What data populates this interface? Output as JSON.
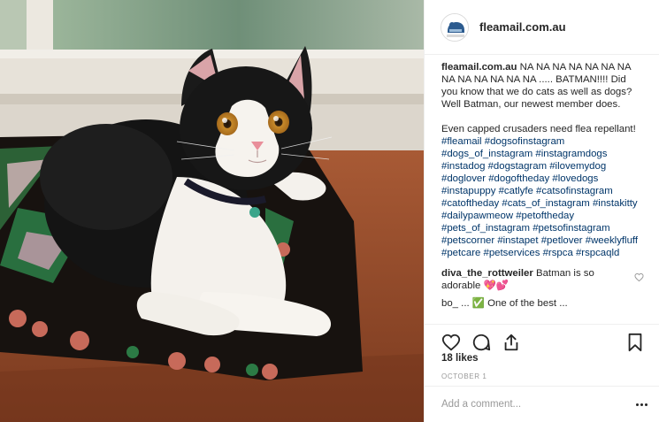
{
  "post": {
    "image_alt": "Black and white kitten lying on a crocheted blanket on a windowsill",
    "account": {
      "username": "fleamail.com.au",
      "avatar_label": "FLEAMAIL"
    },
    "caption": {
      "username": "fleamail.com.au",
      "line1": " NA NA NA NA NA NA NA NA NA NA NA NA NA ..... BATMAN!!!! Did you know that we do cats as well as dogs? Well Batman, our newest member does.",
      "line2": "Even capped crusaders need flea repellant!",
      "hashtags": "#fleamail #dogsofinstagram #dogs_of_instagram #instagramdogs #instadog #dogstagram #ilovemydog #doglover #dogoftheday #lovedogs #instapuppy #catlyfe #catsofinstagram #catoftheday #cats_of_instagram #instakitty #dailypawmeow #petoftheday #pets_of_instagram #petsofinstagram #petscorner #instapet #petlover #weeklyfluff #petcare #petservices #rspca #rspcaqld"
    },
    "comments": [
      {
        "username": "diva_the_rottweiler",
        "text": " Batman is so adorable 💖💕"
      },
      {
        "username": "bo_",
        "text": "",
        "partial": "bo_ ...  ✅ One of the best ..."
      }
    ],
    "likes": "18 likes",
    "date": "OCTOBER 1",
    "add_comment_placeholder": "Add a comment...",
    "icons": {
      "like": "heart-outline-icon",
      "comment": "speech-bubble-icon",
      "share": "share-upload-icon",
      "save": "bookmark-icon",
      "more": "more-options-icon",
      "comment_like": "small-heart-icon"
    }
  }
}
